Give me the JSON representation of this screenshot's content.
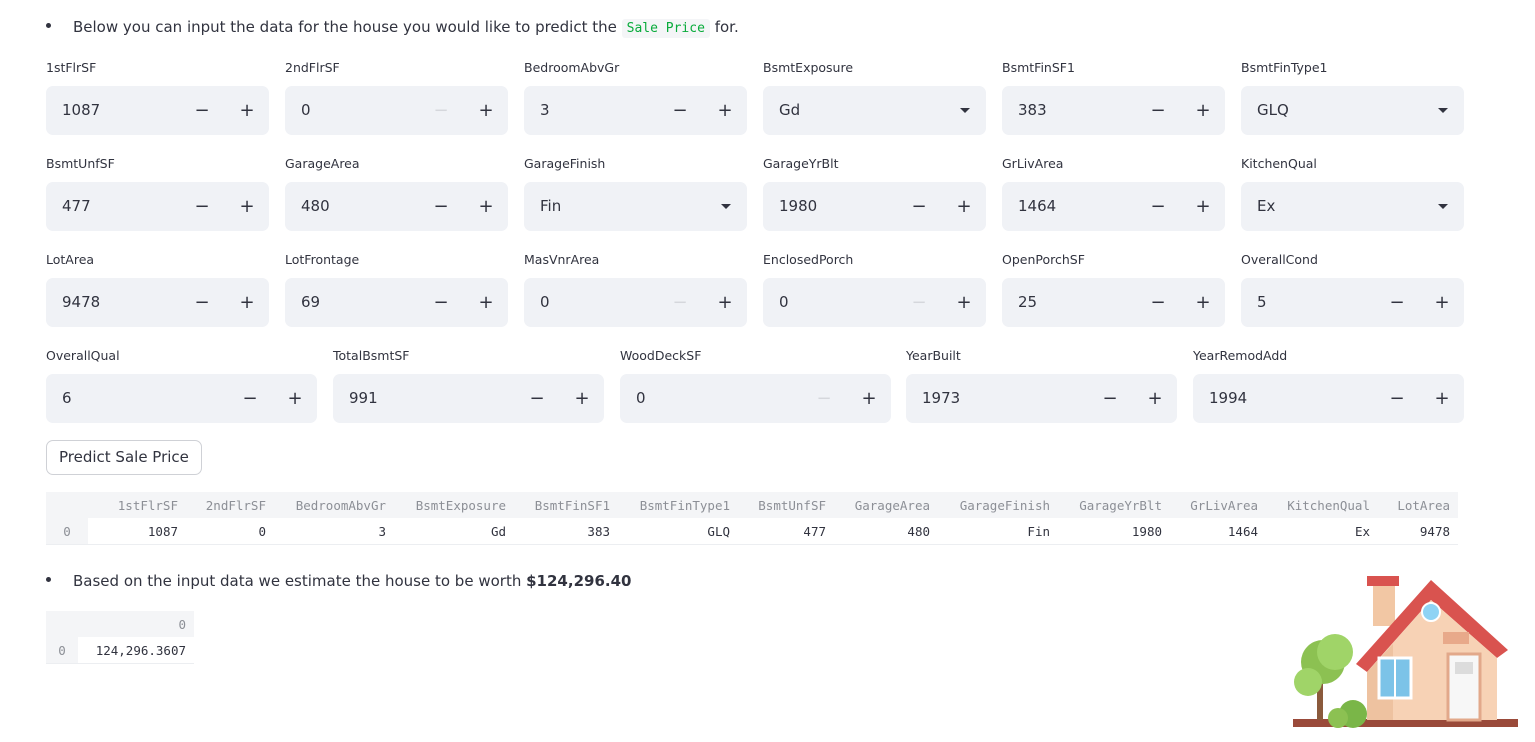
{
  "intro": {
    "prefix": "Below you can input the data for the house you would like to predict the",
    "code": "Sale Price",
    "suffix": "for."
  },
  "fields": [
    {
      "label": "1stFlrSF",
      "value": "1087",
      "type": "number",
      "minus_disabled": false
    },
    {
      "label": "2ndFlrSF",
      "value": "0",
      "type": "number",
      "minus_disabled": true
    },
    {
      "label": "BedroomAbvGr",
      "value": "3",
      "type": "number",
      "minus_disabled": false
    },
    {
      "label": "BsmtExposure",
      "value": "Gd",
      "type": "select"
    },
    {
      "label": "BsmtFinSF1",
      "value": "383",
      "type": "number",
      "minus_disabled": false
    },
    {
      "label": "BsmtFinType1",
      "value": "GLQ",
      "type": "select"
    },
    {
      "label": "BsmtUnfSF",
      "value": "477",
      "type": "number",
      "minus_disabled": false
    },
    {
      "label": "GarageArea",
      "value": "480",
      "type": "number",
      "minus_disabled": false
    },
    {
      "label": "GarageFinish",
      "value": "Fin",
      "type": "select"
    },
    {
      "label": "GarageYrBlt",
      "value": "1980",
      "type": "number",
      "minus_disabled": false
    },
    {
      "label": "GrLivArea",
      "value": "1464",
      "type": "number",
      "minus_disabled": false
    },
    {
      "label": "KitchenQual",
      "value": "Ex",
      "type": "select"
    },
    {
      "label": "LotArea",
      "value": "9478",
      "type": "number",
      "minus_disabled": false
    },
    {
      "label": "LotFrontage",
      "value": "69",
      "type": "number",
      "minus_disabled": false
    },
    {
      "label": "MasVnrArea",
      "value": "0",
      "type": "number",
      "minus_disabled": true
    },
    {
      "label": "EnclosedPorch",
      "value": "0",
      "type": "number",
      "minus_disabled": true
    },
    {
      "label": "OpenPorchSF",
      "value": "25",
      "type": "number",
      "minus_disabled": false
    },
    {
      "label": "OverallCond",
      "value": "5",
      "type": "number",
      "minus_disabled": false
    },
    {
      "label": "OverallQual",
      "value": "6",
      "type": "number",
      "minus_disabled": false
    },
    {
      "label": "TotalBsmtSF",
      "value": "991",
      "type": "number",
      "minus_disabled": false
    },
    {
      "label": "WoodDeckSF",
      "value": "0",
      "type": "number",
      "minus_disabled": true
    },
    {
      "label": "YearBuilt",
      "value": "1973",
      "type": "number",
      "minus_disabled": false
    },
    {
      "label": "YearRemodAdd",
      "value": "1994",
      "type": "number",
      "minus_disabled": false
    }
  ],
  "stepper_symbols": {
    "minus": "−",
    "plus": "+"
  },
  "predict_button": "Predict Sale Price",
  "input_table": {
    "columns": [
      "1stFlrSF",
      "2ndFlrSF",
      "BedroomAbvGr",
      "BsmtExposure",
      "BsmtFinSF1",
      "BsmtFinType1",
      "BsmtUnfSF",
      "GarageArea",
      "GarageFinish",
      "GarageYrBlt",
      "GrLivArea",
      "KitchenQual",
      "LotArea"
    ],
    "rows": [
      {
        "index": "0",
        "cells": [
          "1087",
          "0",
          "3",
          "Gd",
          "383",
          "GLQ",
          "477",
          "480",
          "Fin",
          "1980",
          "1464",
          "Ex",
          "9478"
        ]
      }
    ]
  },
  "result": {
    "prefix": "Based on the input data we estimate the house to be worth",
    "amount": "$124,296.40"
  },
  "result_table": {
    "columns": [
      "0"
    ],
    "rows": [
      {
        "index": "0",
        "cells": [
          "124,296.3607"
        ]
      }
    ]
  },
  "icons": {
    "house": "house-illustration",
    "dropdown": "chevron-down-icon"
  }
}
